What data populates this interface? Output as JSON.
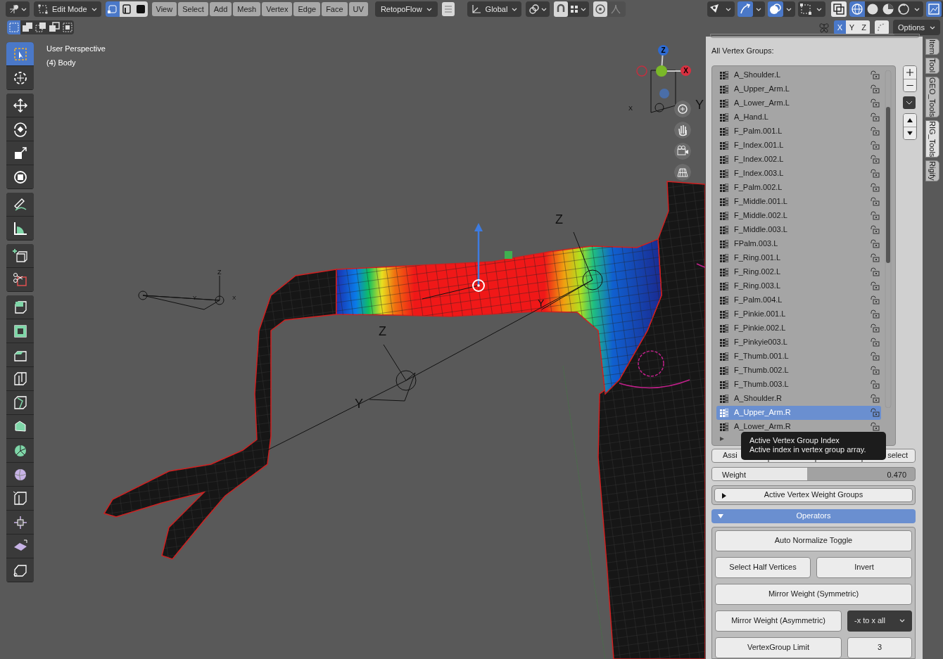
{
  "header": {
    "mode": "Edit Mode",
    "select_modes": [
      {
        "selected": true
      },
      {
        "selected": false
      },
      {
        "selected": false
      }
    ],
    "menus": [
      "View",
      "Select",
      "Add",
      "Mesh",
      "Vertex",
      "Edge",
      "Face",
      "UV"
    ],
    "addon_menu": "RetopoFlow",
    "orientation": "Global",
    "box_select_modes": [
      {
        "selected": true
      },
      {
        "selected": false
      },
      {
        "selected": false
      },
      {
        "selected": false
      },
      {
        "selected": false
      }
    ],
    "shading_modes": [
      {
        "selected": true
      },
      {
        "selected": false
      },
      {
        "selected": false
      },
      {
        "selected": false
      }
    ],
    "mirror_axes": [
      {
        "label": "X",
        "selected": true
      },
      {
        "label": "Y",
        "selected": false
      },
      {
        "label": "Z",
        "selected": false
      }
    ],
    "options": "Options"
  },
  "viewport": {
    "title": "User Perspective",
    "object": "(4) Body",
    "gizmo_labels": [
      "Z",
      "X"
    ],
    "axis_labels": [
      "Y",
      "X",
      "Z",
      "Z",
      "Y",
      "X",
      "Y",
      "Z",
      "Y"
    ]
  },
  "toolbar": {
    "tools": [
      {
        "selected": true
      },
      {
        "selected": false
      },
      {
        "selected": false
      },
      {
        "selected": false
      },
      {
        "selected": false
      },
      {
        "selected": false
      },
      {
        "selected": false
      },
      {
        "selected": false
      },
      {
        "selected": false
      },
      {
        "selected": false
      },
      {
        "selected": false
      },
      {
        "selected": false
      },
      {
        "selected": false
      },
      {
        "selected": false
      },
      {
        "selected": false
      },
      {
        "selected": false
      },
      {
        "selected": false
      },
      {
        "selected": false
      },
      {
        "selected": false
      },
      {
        "selected": false
      },
      {
        "selected": false
      },
      {
        "selected": false
      }
    ]
  },
  "sidebar": {
    "tabs": [
      {
        "label": "Item",
        "selected": false
      },
      {
        "label": "Tool",
        "selected": false
      },
      {
        "label": "GEO_Tools",
        "selected": false
      },
      {
        "label": "RIG_Tools",
        "selected": true
      },
      {
        "label": "Rigify",
        "selected": false
      }
    ],
    "vertex_groups": {
      "heading": "All Vertex Groups:",
      "items": [
        {
          "name": "A_Shoulder.L",
          "selected": false
        },
        {
          "name": "A_Upper_Arm.L",
          "selected": false
        },
        {
          "name": "A_Lower_Arm.L",
          "selected": false
        },
        {
          "name": "A_Hand.L",
          "selected": false
        },
        {
          "name": "F_Palm.001.L",
          "selected": false
        },
        {
          "name": "F_Index.001.L",
          "selected": false
        },
        {
          "name": "F_Index.002.L",
          "selected": false
        },
        {
          "name": "F_Index.003.L",
          "selected": false
        },
        {
          "name": "F_Palm.002.L",
          "selected": false
        },
        {
          "name": "F_Middle.001.L",
          "selected": false
        },
        {
          "name": "F_Middle.002.L",
          "selected": false
        },
        {
          "name": "F_Middle.003.L",
          "selected": false
        },
        {
          "name": "FPalm.003.L",
          "selected": false
        },
        {
          "name": "F_Ring.001.L",
          "selected": false
        },
        {
          "name": "F_Ring.002.L",
          "selected": false
        },
        {
          "name": "F_Ring.003.L",
          "selected": false
        },
        {
          "name": "F_Palm.004.L",
          "selected": false
        },
        {
          "name": "F_Pinkie.001.L",
          "selected": false
        },
        {
          "name": "F_Pinkie.002.L",
          "selected": false
        },
        {
          "name": "F_Pinkyie003.L",
          "selected": false
        },
        {
          "name": "F_Thumb.001.L",
          "selected": false
        },
        {
          "name": "F_Thumb.002.L",
          "selected": false
        },
        {
          "name": "F_Thumb.003.L",
          "selected": false
        },
        {
          "name": "A_Shoulder.R",
          "selected": false
        },
        {
          "name": "A_Upper_Arm.R",
          "selected": true
        },
        {
          "name": "A_Lower_Arm.R",
          "selected": false
        }
      ]
    },
    "group_buttons": [
      "Assi",
      "select"
    ],
    "weight": {
      "label": "Weight",
      "reading": "0.470",
      "level": 0.47
    },
    "panels": [
      {
        "title": "Active Vertex Weight Groups",
        "expanded": false
      },
      {
        "title": "Operators",
        "expanded": true
      }
    ],
    "operators": [
      [
        {
          "kind": "button",
          "label": "Auto Normalize Toggle"
        }
      ],
      [
        {
          "kind": "button",
          "label": "Select Half Vertices"
        },
        {
          "kind": "button",
          "label": "Invert"
        }
      ],
      [
        {
          "kind": "button",
          "label": "Mirror Weight (Symmetric)"
        }
      ],
      [
        {
          "kind": "button",
          "label": "Mirror Weight (Asymmetric)"
        },
        {
          "kind": "dropdown",
          "label": "-x to x all"
        }
      ],
      [
        {
          "kind": "button",
          "label": "VertexGroup Limit"
        },
        {
          "kind": "field",
          "value": "3"
        }
      ]
    ]
  },
  "tooltip": {
    "title": "Active Vertex Group Index",
    "text": "Active index in vertex group array."
  }
}
